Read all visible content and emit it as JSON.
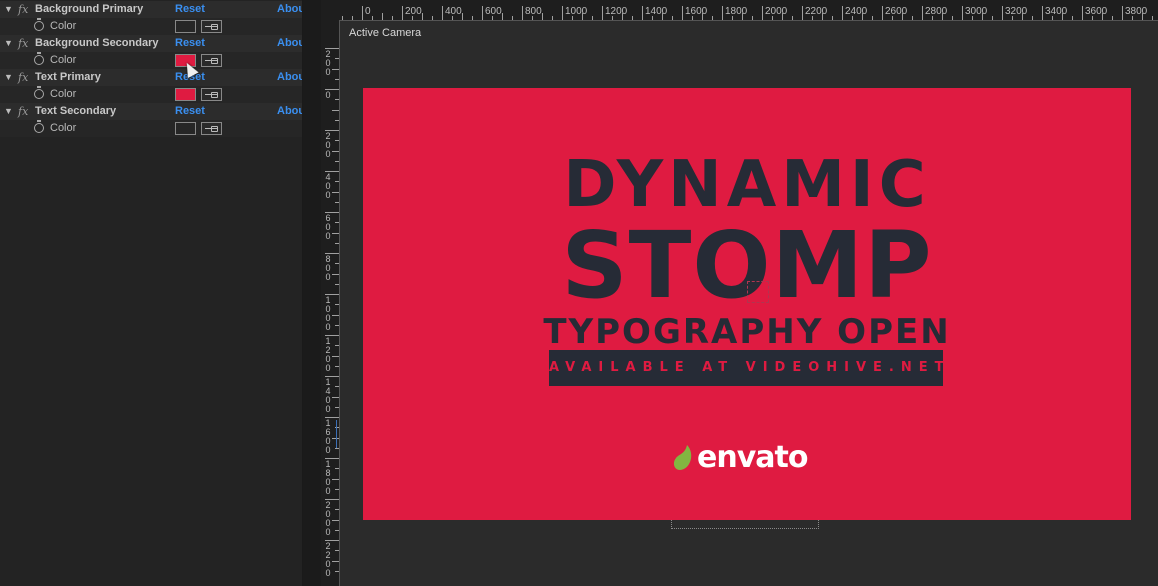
{
  "effects_panel": {
    "reset_label": "Reset",
    "about_label": "About...",
    "badge": "fx",
    "effects": [
      {
        "name": "Background Primary",
        "property": "Color",
        "swatch": "#262626"
      },
      {
        "name": "Background Secondary",
        "property": "Color",
        "swatch": "#df1b41"
      },
      {
        "name": "Text Primary",
        "property": "Color",
        "swatch": "#df1b41"
      },
      {
        "name": "Text Secondary",
        "property": "Color",
        "swatch": "#262626"
      }
    ]
  },
  "viewer": {
    "camera_label": "Active Camera",
    "ruler_h": [
      "0",
      "200",
      "400",
      "600",
      "800",
      "1000",
      "1200",
      "1400",
      "1600",
      "1800",
      "2000",
      "2200",
      "2400",
      "2600",
      "2800",
      "3000",
      "3200",
      "3400",
      "3600",
      "3800"
    ],
    "ruler_v": [
      "200",
      "0",
      "200",
      "400",
      "600",
      "800",
      "1000",
      "1200",
      "1400",
      "1600",
      "1800",
      "2000",
      "2200"
    ]
  },
  "composition": {
    "background": "#df1b41",
    "text_color": "#262b36",
    "line1": "DYNAMIC",
    "line2": "STOMP",
    "line3": "TYPOGRAPHY OPEN",
    "banner": "AVAILABLE AT VIDEOHIVE.NET",
    "logo_text": "envato",
    "logo_leaf_color": "#82b541"
  }
}
